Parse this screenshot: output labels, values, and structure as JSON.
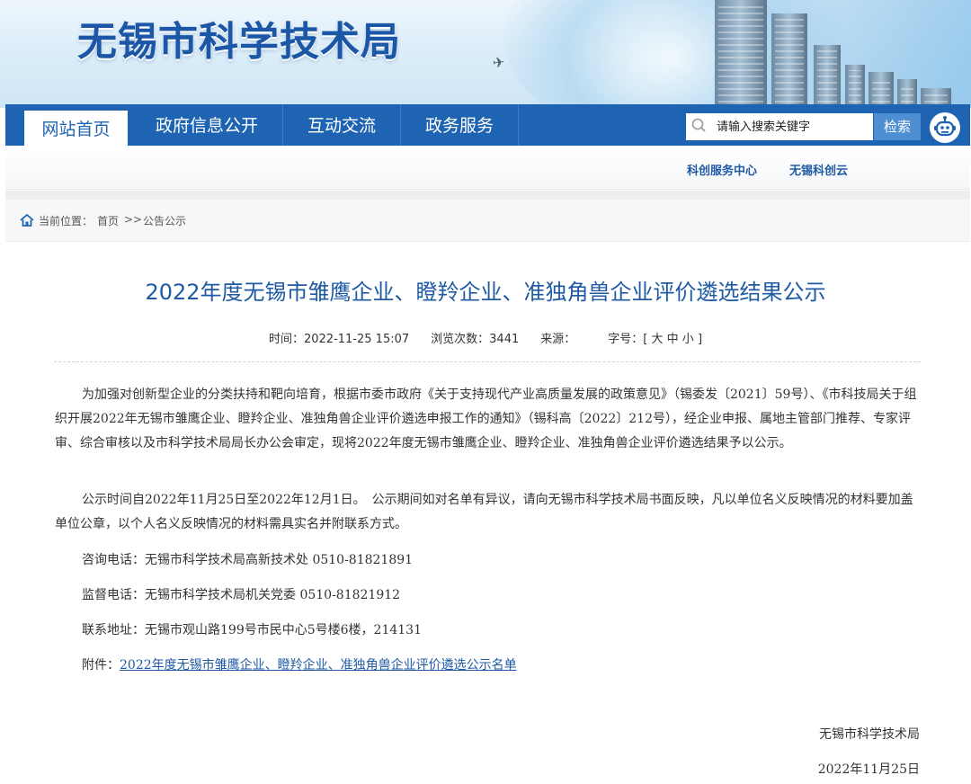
{
  "site": {
    "title": "无锡市科学技术局"
  },
  "nav": {
    "items": [
      "网站首页",
      "政府信息公开",
      "互动交流",
      "政务服务"
    ],
    "active_index": 0
  },
  "search": {
    "placeholder": "请输入搜索关键字",
    "button_label": "检索"
  },
  "subnav": {
    "links": [
      "科创服务中心",
      "无锡科创云"
    ]
  },
  "breadcrumb": {
    "prefix": "当前位置：",
    "home": "首页",
    "separator": ">>",
    "current": "公告公示"
  },
  "article": {
    "title": "2022年度无锡市雏鹰企业、瞪羚企业、准独角兽企业评价遴选结果公示",
    "meta": {
      "time_label": "时间：",
      "time_value": "2022-11-25 15:07",
      "views_label": "浏览次数：",
      "views_value": "3441",
      "source_label": "来源：",
      "source_value": "",
      "fontsize_label": "字号：[",
      "fontsize_large": "大",
      "fontsize_medium": "中",
      "fontsize_small": "小",
      "fontsize_end": "]"
    },
    "paragraphs": [
      "为加强对创新型企业的分类扶持和靶向培育，根据市委市政府《关于支持现代产业高质量发展的政策意见》（锡委发〔2021〕59号）、《市科技局关于组织开展2022年无锡市雏鹰企业、瞪羚企业、准独角兽企业评价遴选申报工作的通知》（锡科高〔2022〕212号），经企业申报、属地主管部门推荐、专家评审、综合审核以及市科学技术局局长办公会审定，现将2022年度无锡市雏鹰企业、瞪羚企业、准独角兽企业评价遴选结果予以公示。",
      "公示时间自2022年11月25日至2022年12月1日。　公示期间如对名单有异议，请向无锡市科学技术局书面反映，凡以单位名义反映情况的材料要加盖单位公章，以个人名义反映情况的材料需具实名并附联系方式。"
    ],
    "consult": "咨询电话：无锡市科学技术局高新技术处 0510-81821891",
    "supervise": "监督电话：无锡市科学技术局机关党委 0510-81821912",
    "address": "联系地址：无锡市观山路199号市民中心5号楼6楼，214131",
    "attachment_label": "附件：",
    "attachment_link": "2022年度无锡市雏鹰企业、瞪羚企业、准独角兽企业评价遴选公示名单",
    "signature": "无锡市科学技术局",
    "date": "2022年11月25日"
  },
  "colors": {
    "brand_blue": "#1f64b3",
    "link_blue": "#1f5aa5",
    "search_button": "#4e8fd3"
  }
}
